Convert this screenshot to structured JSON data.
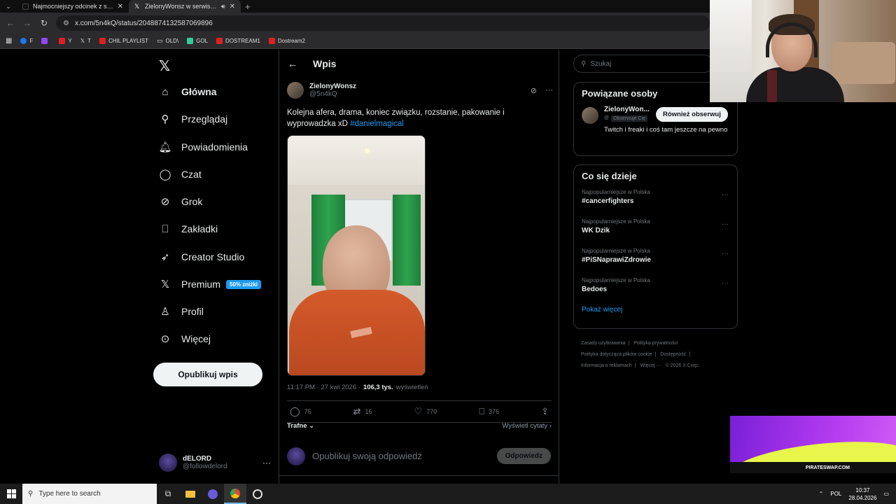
{
  "browser": {
    "tabs": [
      {
        "title": "Najmocniejszy odcinek z serii e",
        "active": false
      },
      {
        "title": "ZielonyWonsz w serwisie X",
        "active": true
      }
    ],
    "url": "x.com/5n4kQ/status/2048874132587069896",
    "bookmarks": [
      {
        "label": "F"
      },
      {
        "label": ""
      },
      {
        "label": "Y"
      },
      {
        "label": "T"
      },
      {
        "label": "CHIL PLAYLIST"
      },
      {
        "label": "OLD\\"
      },
      {
        "label": "GOL"
      },
      {
        "label": "DOSTREAM1"
      },
      {
        "label": "Dostream2"
      }
    ]
  },
  "nav": {
    "items": [
      {
        "label": "Główna",
        "icon": "home-icon"
      },
      {
        "label": "Przeglądaj",
        "icon": "search-icon"
      },
      {
        "label": "Powiadomienia",
        "icon": "bell-icon"
      },
      {
        "label": "Czat",
        "icon": "chat-icon"
      },
      {
        "label": "Grok",
        "icon": "grok-icon"
      },
      {
        "label": "Zakładki",
        "icon": "bookmark-icon"
      },
      {
        "label": "Creator Studio",
        "icon": "rocket-icon"
      },
      {
        "label": "Premium",
        "icon": "x-icon"
      },
      {
        "label": "Profil",
        "icon": "person-icon"
      },
      {
        "label": "Więcej",
        "icon": "more-circle-icon"
      }
    ],
    "premium_badge": "50% zniżki",
    "publish_label": "Opublikuj wpis",
    "account": {
      "name": "dELORD",
      "handle": "@followdelord"
    }
  },
  "post": {
    "header_title": "Wpis",
    "author_name": "ZielonyWonsz",
    "author_handle": "@5n4kQ",
    "text": "Kolejna afera, drama, koniec związku, rozstanie, pakowanie i wyprowadzka xD",
    "hashtag": "#danielmagical",
    "time": "11:17 PM · 27 kwi 2026 ·",
    "views_count": "106,3 tys.",
    "views_label": "wyświetleń",
    "replies": "75",
    "reposts": "16",
    "likes": "770",
    "bookmarks": "376",
    "sort_label": "Trafne",
    "quotes_label": "Wyświetl cytaty",
    "reply_placeholder": "Opublikuj swoją odpowiedź",
    "reply_button": "Odpowiedz"
  },
  "right": {
    "search_placeholder": "Szukaj",
    "related_title": "Powiązane osoby",
    "related": {
      "name": "ZielonyWon...",
      "follows_you": "Obserwuje Cię",
      "follow_label": "Również obserwuj",
      "bio": "Twitch i freaki i coś tam jeszcze na pewno"
    },
    "trends_title": "Co się dzieje",
    "trends": [
      {
        "context": "Najpopularniejsze w Polska",
        "name": "#cancerfighters"
      },
      {
        "context": "Najpopularniejsze w Polska",
        "name": "WK Dzik"
      },
      {
        "context": "Najpopularniejsze w Polska",
        "name": "#PiSNaprawiZdrowie"
      },
      {
        "context": "Najpopularniejsze w Polska",
        "name": "Bedoes"
      }
    ],
    "show_more": "Pokaż więcej",
    "footer": [
      "Zasady użytkowania",
      "|",
      "Polityka prywatności",
      "|",
      "Polityka dotycząca plików cookie",
      "|",
      "Dostępność",
      "|",
      "Informacja o reklamach",
      "Więcej ···",
      "© 2026 X Corp."
    ]
  },
  "ad": {
    "text": "PIRATESWAP.COM"
  },
  "taskbar": {
    "search_placeholder": "Type here to search",
    "lang": "POL",
    "time": "10:37",
    "date": "28.04.2026"
  }
}
